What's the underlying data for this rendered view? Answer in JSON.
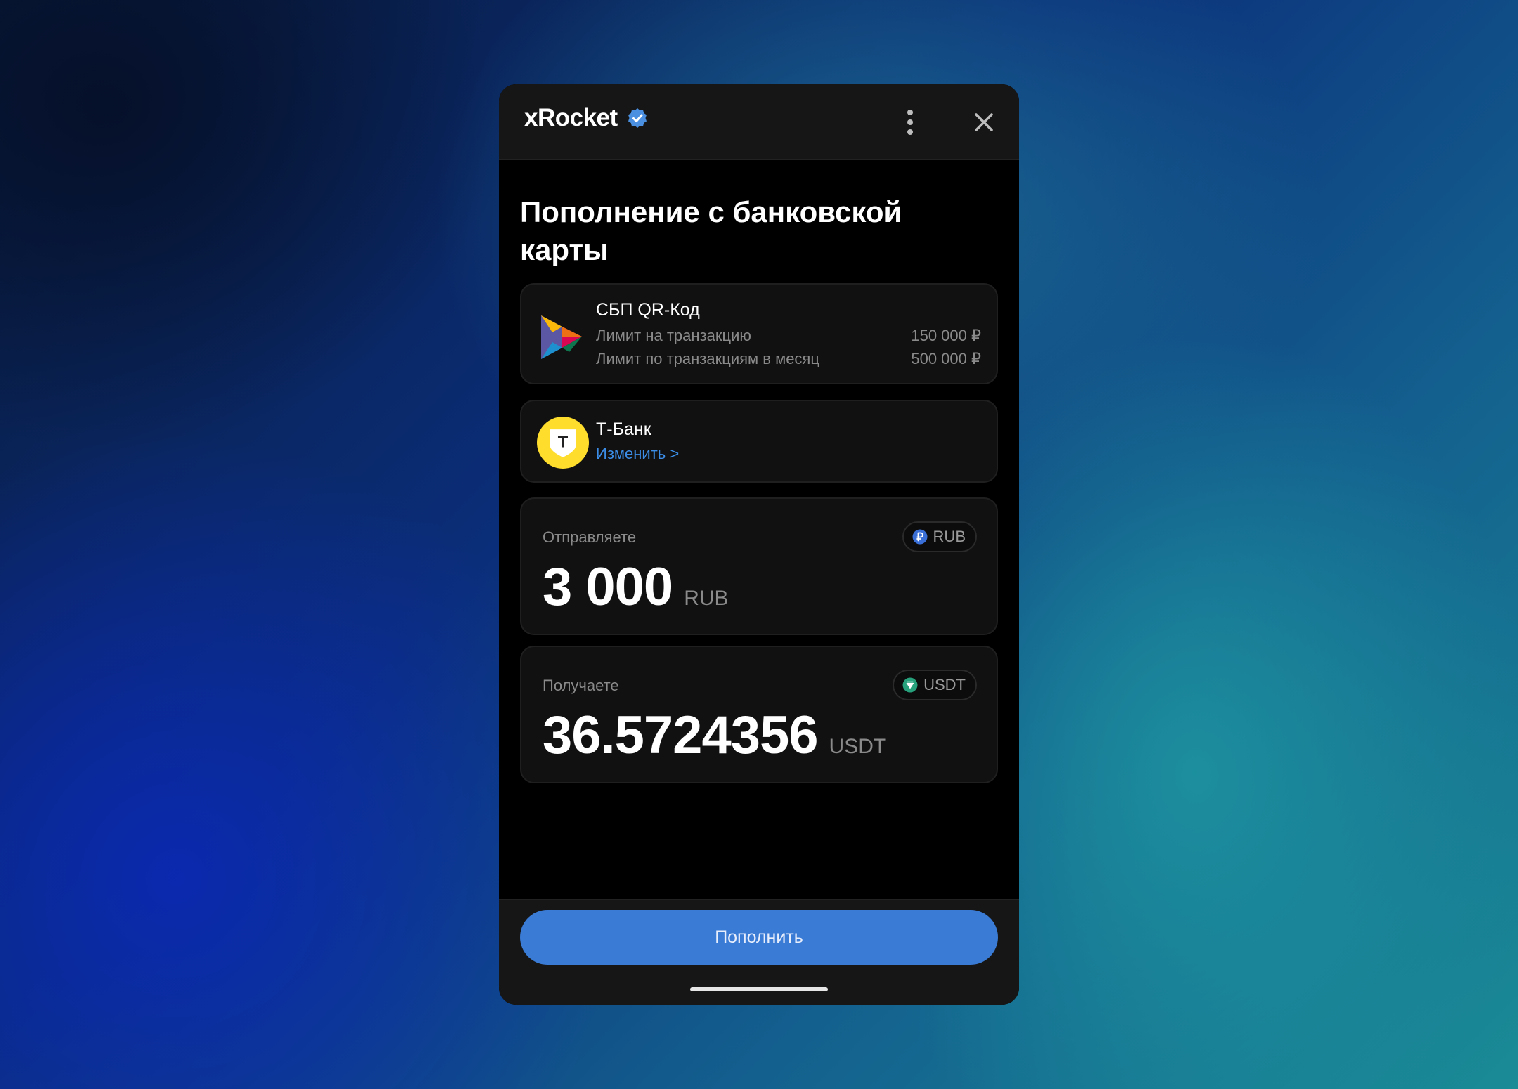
{
  "header": {
    "title": "xRocket",
    "verified_icon": "verified-badge-icon",
    "menu_icon": "more-vertical-icon",
    "close_icon": "close-icon"
  },
  "page": {
    "title": "Пополнение с банковской карты"
  },
  "sbp": {
    "name": "СБП QR-Код",
    "limits": [
      {
        "label": "Лимит на транзакцию",
        "value": "150 000 ₽"
      },
      {
        "label": "Лимит по транзакциям в месяц",
        "value": "500 000 ₽"
      }
    ]
  },
  "bank": {
    "name": "Т-Банк",
    "change_label": "Изменить >",
    "logo_letter": "T"
  },
  "send": {
    "label": "Отправляете",
    "currency": "RUB",
    "amount": "3 000",
    "unit": "RUB"
  },
  "receive": {
    "label": "Получаете",
    "currency": "USDT",
    "amount": "36.5724356",
    "unit": "USDT"
  },
  "footer": {
    "submit_label": "Пополнить"
  },
  "colors": {
    "accent": "#3a7bd5",
    "link": "#3b8de6",
    "bank_yellow": "#ffdd2d"
  }
}
